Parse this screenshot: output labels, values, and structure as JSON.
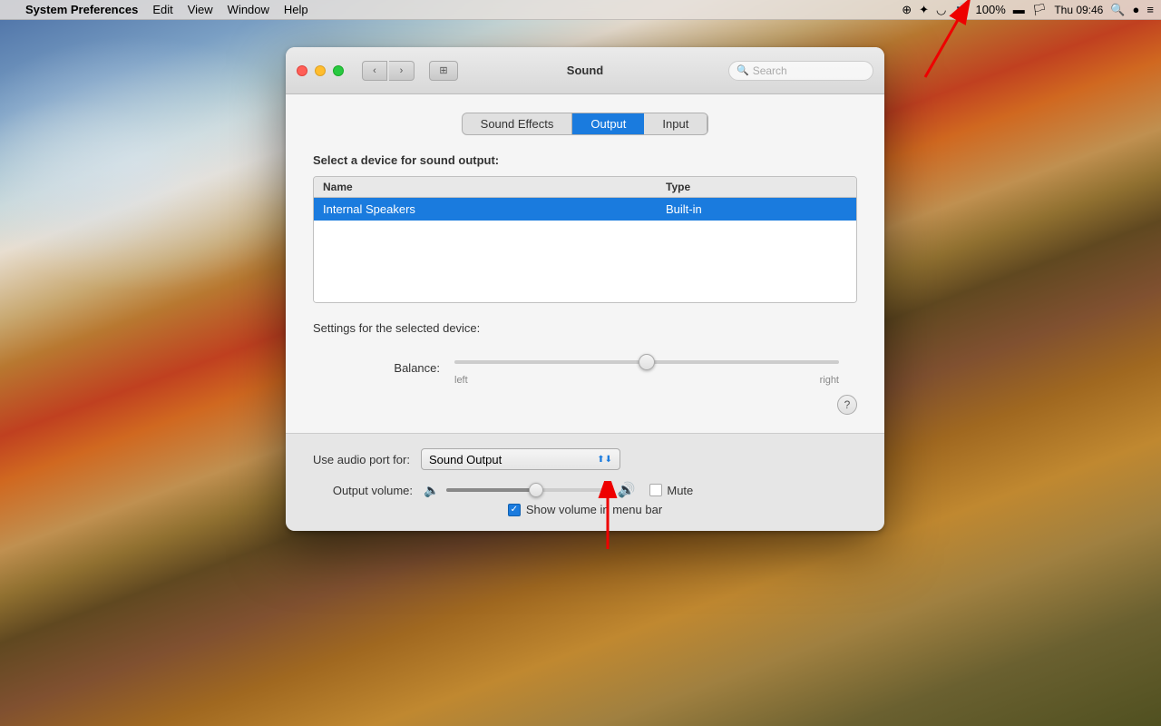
{
  "menubar": {
    "apple": "",
    "app_name": "System Preferences",
    "menus": [
      "Edit",
      "View",
      "Window",
      "Help"
    ],
    "right_icons": [
      "target-icon",
      "bluetooth-icon",
      "wifi-icon",
      "volume-icon"
    ],
    "battery": "100%",
    "time": "Thu 09:46"
  },
  "window": {
    "title": "Sound",
    "search_placeholder": "Search",
    "tabs": [
      {
        "id": "sound-effects",
        "label": "Sound Effects",
        "active": false
      },
      {
        "id": "output",
        "label": "Output",
        "active": true
      },
      {
        "id": "input",
        "label": "Input",
        "active": false
      }
    ],
    "output": {
      "select_device_label": "Select a device for sound output:",
      "table_headers": {
        "name": "Name",
        "type": "Type"
      },
      "devices": [
        {
          "name": "Internal Speakers",
          "type": "Built-in",
          "selected": true
        }
      ],
      "settings_label": "Settings for the selected device:",
      "balance": {
        "label": "Balance:",
        "left_label": "left",
        "right_label": "right",
        "value": 50
      },
      "help_label": "?"
    },
    "bottom": {
      "audio_port_label": "Use audio port for:",
      "audio_port_value": "Sound Output",
      "output_volume_label": "Output volume:",
      "mute_label": "Mute",
      "show_volume_label": "Show volume in menu bar",
      "show_volume_checked": true,
      "volume_value": 55
    }
  }
}
